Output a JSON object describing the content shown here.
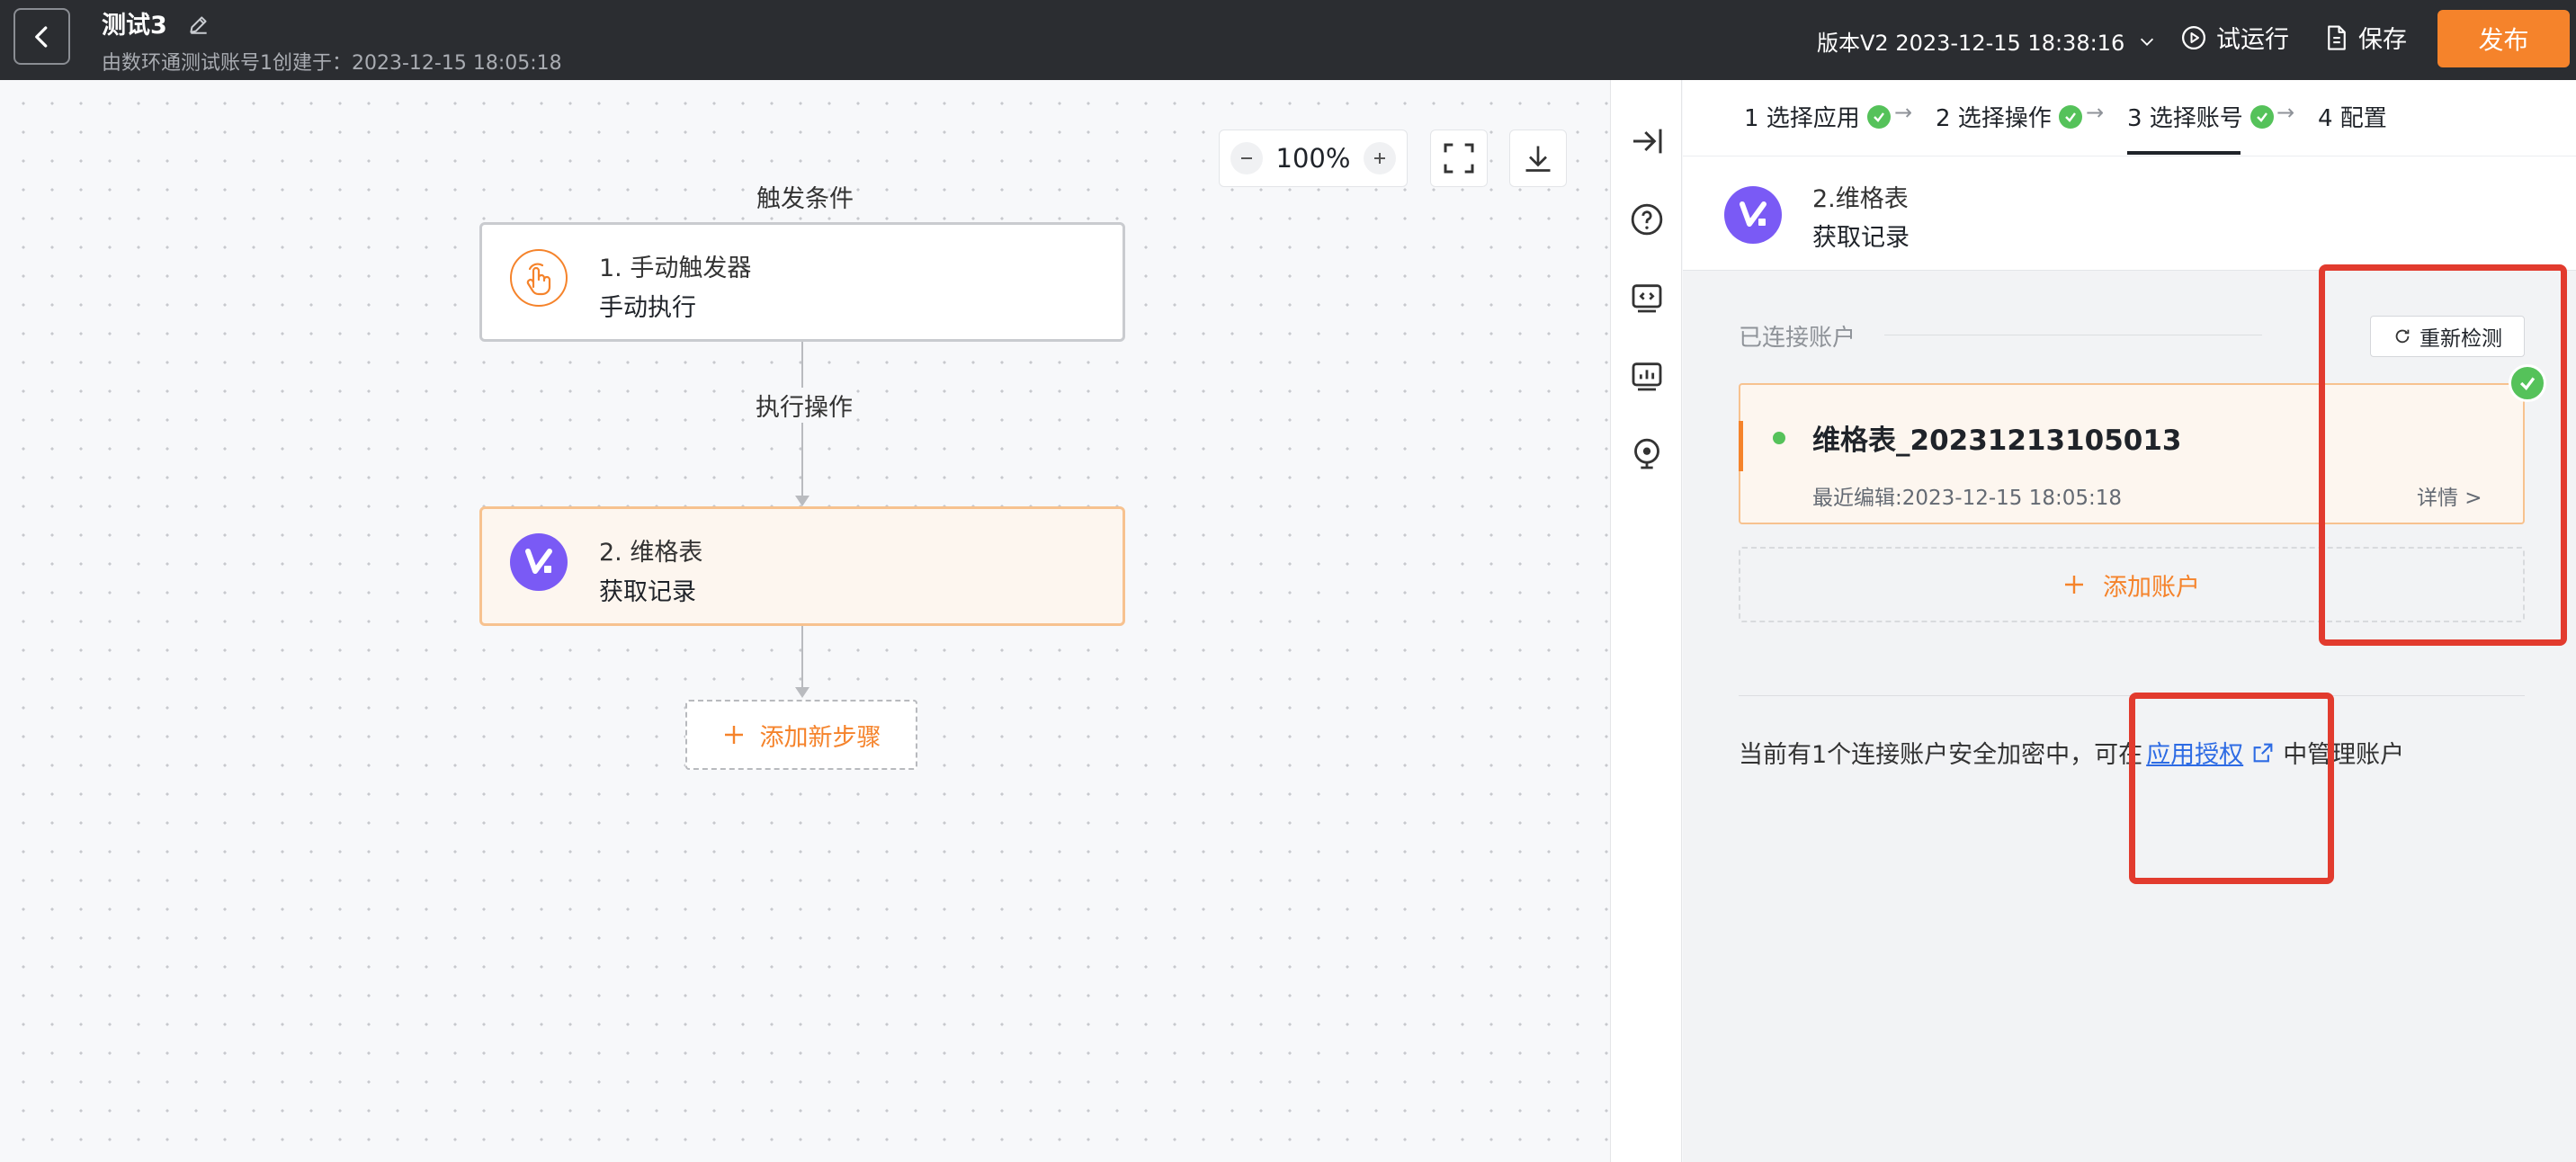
{
  "header": {
    "title": "测试3",
    "subtitle": "由数环通测试账号1创建于：2023-12-15 18:05:18",
    "version": "版本V2 2023-12-15 18:38:16",
    "test_run": "试运行",
    "save": "保存",
    "publish": "发布"
  },
  "canvas": {
    "zoom_level": "100%",
    "trigger_label": "触发条件",
    "action_label": "执行操作",
    "nodes": [
      {
        "title": "1. 手动触发器",
        "subtitle": "手动执行"
      },
      {
        "title": "2. 维格表",
        "subtitle": "获取记录"
      }
    ],
    "add_step": "添加新步骤"
  },
  "panel": {
    "steps": [
      {
        "label": "1 选择应用"
      },
      {
        "label": "2 选择操作"
      },
      {
        "label": "3 选择账号"
      },
      {
        "label": "4 配置"
      }
    ],
    "app_name": "2.维格表",
    "app_action": "获取记录",
    "connected_label": "已连接账户",
    "recheck": "重新检测",
    "account": {
      "name": "维格表_20231213105013",
      "last_edit": "最近编辑:2023-12-15 18:05:18",
      "detail": "详情 >"
    },
    "add_account": "添加账户",
    "note_before": "当前有1个连接账户安全加密中，可在",
    "note_link": "应用授权",
    "note_after": "中管理账户"
  },
  "colors": {
    "accent": "#f5832b",
    "success": "#55c25a",
    "topbar": "#2b2d31",
    "app_brand": "#7a5af5",
    "highlight": "#e23b2e"
  }
}
